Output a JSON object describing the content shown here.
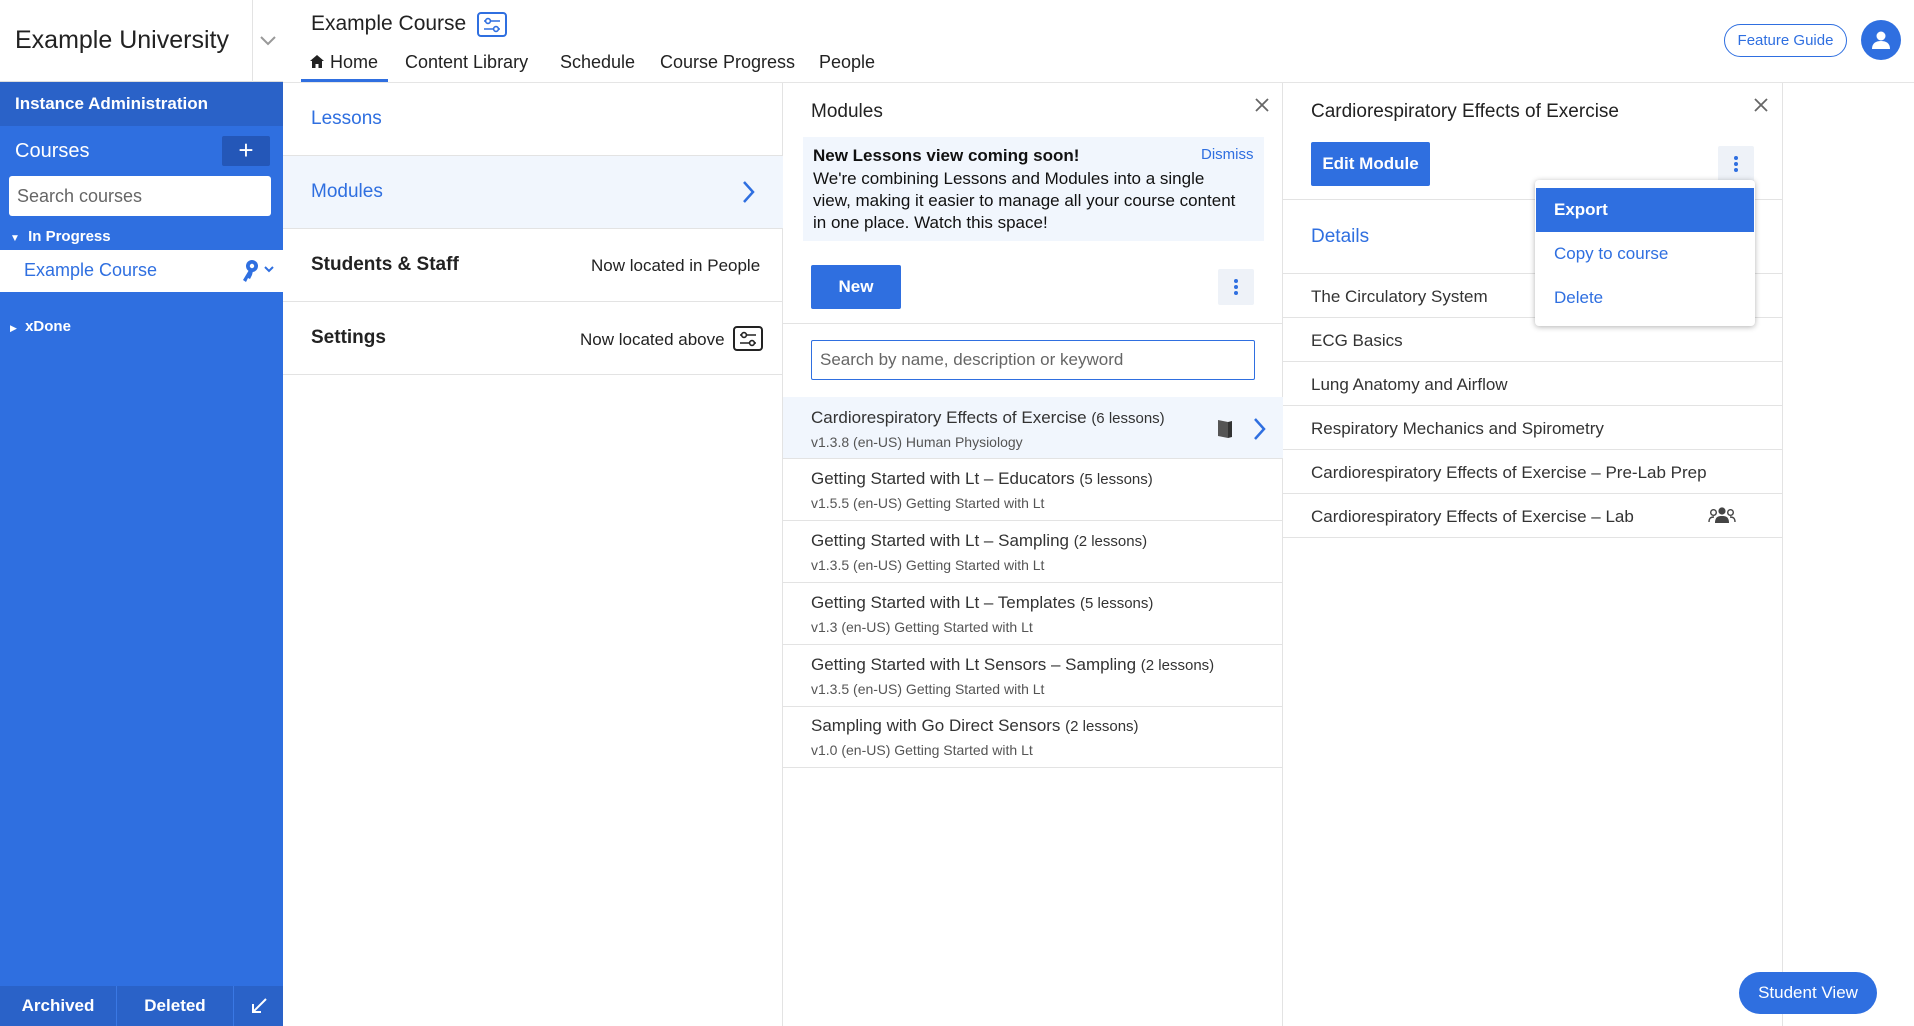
{
  "sidebar": {
    "institution": "Example University",
    "instance_admin": "Instance Administration",
    "courses_label": "Courses",
    "add_symbol": "+",
    "search_placeholder": "Search courses",
    "group_in_progress": "In Progress",
    "course_item": "Example Course",
    "group_done": "xDone",
    "footer": {
      "archived": "Archived",
      "deleted": "Deleted"
    }
  },
  "header": {
    "course_title": "Example Course",
    "tabs": [
      {
        "label": "Home"
      },
      {
        "label": "Content Library"
      },
      {
        "label": "Schedule"
      },
      {
        "label": "Course Progress"
      },
      {
        "label": "People"
      }
    ],
    "feature_guide": "Feature Guide"
  },
  "home_panel": {
    "lessons": "Lessons",
    "modules": "Modules",
    "students_staff": "Students & Staff",
    "students_staff_note": "Now located in People",
    "settings": "Settings",
    "settings_note": "Now located above"
  },
  "modules_panel": {
    "title": "Modules",
    "banner": {
      "title": "New Lessons view coming soon!",
      "dismiss": "Dismiss",
      "body": "We're combining Lessons and Modules into a single view, making it easier to manage all your course content in one place. Watch this space!"
    },
    "new_button": "New",
    "search_placeholder": "Search by name, description or keyword",
    "items": [
      {
        "name": "Cardiorespiratory Effects of Exercise",
        "count": "(6 lessons)",
        "meta": "v1.3.8 (en-US) Human Physiology",
        "selected": true
      },
      {
        "name": "Getting Started with Lt – Educators",
        "count": "(5 lessons)",
        "meta": "v1.5.5 (en-US) Getting Started with Lt"
      },
      {
        "name": "Getting Started with Lt – Sampling",
        "count": "(2 lessons)",
        "meta": "v1.3.5 (en-US) Getting Started with Lt"
      },
      {
        "name": "Getting Started with Lt – Templates",
        "count": "(5 lessons)",
        "meta": "v1.3 (en-US) Getting Started with Lt"
      },
      {
        "name": "Getting Started with Lt Sensors – Sampling",
        "count": "(2 lessons)",
        "meta": "v1.3.5 (en-US) Getting Started with Lt"
      },
      {
        "name": "Sampling with Go Direct Sensors",
        "count": "(2 lessons)",
        "meta": "v1.0 (en-US) Getting Started with Lt"
      }
    ]
  },
  "detail_panel": {
    "title": "Cardiorespiratory Effects of Exercise",
    "edit_button": "Edit Module",
    "details_label": "Details",
    "lessons": [
      "The Circulatory System",
      "ECG Basics",
      "Lung Anatomy and Airflow",
      "Respiratory Mechanics and Spirometry",
      "Cardiorespiratory Effects of Exercise – Pre-Lab Prep",
      "Cardiorespiratory Effects of Exercise – Lab"
    ],
    "menu": {
      "export": "Export",
      "copy": "Copy to course",
      "delete": "Delete"
    }
  },
  "student_view": "Student View",
  "colors": {
    "accent": "#2f6fe0",
    "sidebar": "#2f6fe0",
    "highlight_row": "#f1f6fd"
  }
}
